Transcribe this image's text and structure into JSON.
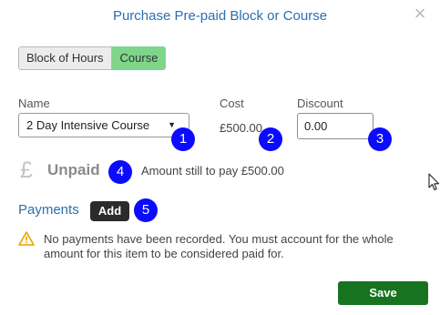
{
  "dialog": {
    "title": "Purchase Pre-paid Block or Course",
    "close_symbol": "×"
  },
  "type_toggle": {
    "options": [
      "Block of Hours",
      "Course"
    ],
    "selected": "Course"
  },
  "fields": {
    "name_label": "Name",
    "name_value": "2 Day Intensive Course",
    "cost_label": "Cost",
    "cost_value": "£500.00",
    "discount_label": "Discount",
    "discount_value": "0.00"
  },
  "status": {
    "currency_symbol": "£",
    "label": "Unpaid",
    "remaining_text": "Amount still to pay £500.00"
  },
  "payments": {
    "label": "Payments",
    "add_label": "Add",
    "warning_text": "No payments have been recorded. You must account for the whole amount for this item to be considered paid for."
  },
  "footer": {
    "save_label": "Save"
  },
  "annotations": [
    "1",
    "2",
    "3",
    "4",
    "5"
  ],
  "colors": {
    "title": "#2a6fb0",
    "selected_toggle": "#7fd58a",
    "save": "#17731f",
    "badge": "#0b0bff",
    "warning": "#e3a400"
  }
}
